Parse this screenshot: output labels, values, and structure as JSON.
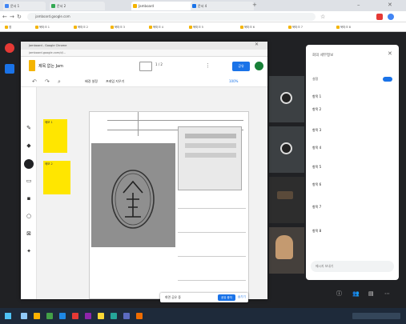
{
  "browser": {
    "tabs": [
      "문서 1",
      "문서 2",
      "Jamboard",
      "문서 4"
    ],
    "url": "jamboard.google.com",
    "bookmarks": [
      "앱",
      "북마크 1",
      "북마크 2",
      "북마크 3",
      "북마크 4",
      "북마크 5",
      "북마크 6",
      "북마크 7",
      "북마크 8"
    ]
  },
  "popup": {
    "title": "Jamboard - Google Chrome",
    "url": "jamboard.google.com/d/...",
    "doc_title": "제목 없는 Jam",
    "frame_counter": "1 / 2",
    "share_label": "공유",
    "toolbar": {
      "set_bg": "배경 설정",
      "clear": "프레임 지우기",
      "zoom": "100%"
    },
    "stickies": [
      "메모 1",
      "메모 2"
    ]
  },
  "share_toast": {
    "text": "화면 공유 중",
    "stop": "공유 중지",
    "hide": "숨기기"
  },
  "side_panel": {
    "title": "회의 세부정보",
    "toggle_label": "설정",
    "fields": [
      "항목 1",
      "항목 2",
      "항목 3",
      "항목 4",
      "항목 5",
      "항목 6",
      "항목 7",
      "항목 8"
    ],
    "footer": "메시지 보내기"
  },
  "colors": {
    "accent": "#1a73e8",
    "sticky": "#ffe600",
    "meet_bg": "#202124"
  }
}
